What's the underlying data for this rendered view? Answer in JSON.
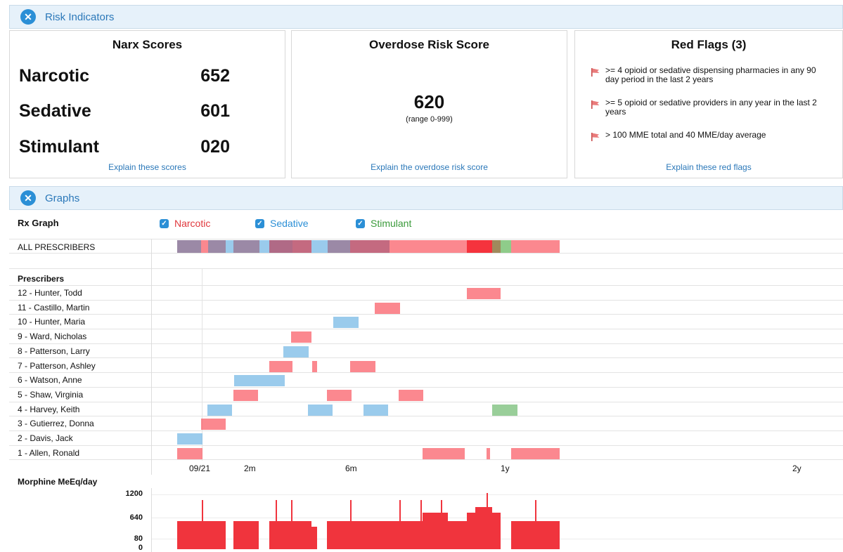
{
  "risk_section": {
    "title": "Risk Indicators",
    "toggle_icon": "close-icon"
  },
  "narx": {
    "title": "Narx Scores",
    "scores": [
      {
        "label": "Narcotic",
        "value": "652"
      },
      {
        "label": "Sedative",
        "value": "601"
      },
      {
        "label": "Stimulant",
        "value": "020"
      }
    ],
    "link": "Explain these scores"
  },
  "overdose": {
    "title": "Overdose Risk Score",
    "value": "620",
    "range": "(range 0-999)",
    "link": "Explain the overdose risk score"
  },
  "red_flags": {
    "title": "Red Flags (3)",
    "items": [
      ">= 4 opioid or sedative dispensing pharmacies in any 90 day period in the last 2 years",
      ">= 5 opioid or sedative providers in any year in the last 2 years",
      "> 100 MME total and 40 MME/day average"
    ],
    "link": "Explain these red flags",
    "flag_color": "#e35d5d"
  },
  "graphs_section": {
    "title": "Graphs",
    "toggle_icon": "close-icon"
  },
  "rx_graph": {
    "label": "Rx Graph",
    "legend": [
      {
        "label": "Narcotic",
        "color": "#e0383d"
      },
      {
        "label": "Sedative",
        "color": "#2b8fd6"
      },
      {
        "label": "Stimulant",
        "color": "#3a9a3a"
      }
    ],
    "all_prescribers_label": "ALL PRESCRIBERS",
    "prescribers_header": "Prescribers",
    "prescribers": [
      "12 - Hunter, Todd",
      "11 - Castillo, Martin",
      "10 - Hunter, Maria",
      "9 - Ward, Nicholas",
      "8 - Patterson, Larry",
      "7 - Patterson, Ashley",
      "6 - Watson, Anne",
      "5 - Shaw, Virginia",
      "4 - Harvey, Keith",
      "3 - Gutierrez, Donna",
      "2 - Davis, Jack",
      "1 - Allen, Ronald"
    ],
    "time_ticks": [
      "09/21",
      "2m",
      "6m",
      "1y",
      "2y"
    ]
  },
  "mme": {
    "title": "Morphine MeEq/day",
    "ticks": [
      "1200",
      "640",
      "80",
      "0"
    ],
    "color": "#f0343d"
  }
}
